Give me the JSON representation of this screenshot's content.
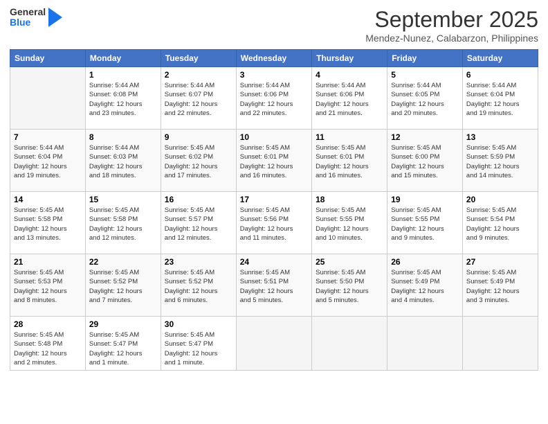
{
  "header": {
    "logo_line1": "General",
    "logo_line2": "Blue",
    "month": "September 2025",
    "location": "Mendez-Nunez, Calabarzon, Philippines"
  },
  "days_of_week": [
    "Sunday",
    "Monday",
    "Tuesday",
    "Wednesday",
    "Thursday",
    "Friday",
    "Saturday"
  ],
  "weeks": [
    [
      {
        "day": "",
        "info": ""
      },
      {
        "day": "1",
        "info": "Sunrise: 5:44 AM\nSunset: 6:08 PM\nDaylight: 12 hours\nand 23 minutes."
      },
      {
        "day": "2",
        "info": "Sunrise: 5:44 AM\nSunset: 6:07 PM\nDaylight: 12 hours\nand 22 minutes."
      },
      {
        "day": "3",
        "info": "Sunrise: 5:44 AM\nSunset: 6:06 PM\nDaylight: 12 hours\nand 22 minutes."
      },
      {
        "day": "4",
        "info": "Sunrise: 5:44 AM\nSunset: 6:06 PM\nDaylight: 12 hours\nand 21 minutes."
      },
      {
        "day": "5",
        "info": "Sunrise: 5:44 AM\nSunset: 6:05 PM\nDaylight: 12 hours\nand 20 minutes."
      },
      {
        "day": "6",
        "info": "Sunrise: 5:44 AM\nSunset: 6:04 PM\nDaylight: 12 hours\nand 19 minutes."
      }
    ],
    [
      {
        "day": "7",
        "info": "Sunrise: 5:44 AM\nSunset: 6:04 PM\nDaylight: 12 hours\nand 19 minutes."
      },
      {
        "day": "8",
        "info": "Sunrise: 5:44 AM\nSunset: 6:03 PM\nDaylight: 12 hours\nand 18 minutes."
      },
      {
        "day": "9",
        "info": "Sunrise: 5:45 AM\nSunset: 6:02 PM\nDaylight: 12 hours\nand 17 minutes."
      },
      {
        "day": "10",
        "info": "Sunrise: 5:45 AM\nSunset: 6:01 PM\nDaylight: 12 hours\nand 16 minutes."
      },
      {
        "day": "11",
        "info": "Sunrise: 5:45 AM\nSunset: 6:01 PM\nDaylight: 12 hours\nand 16 minutes."
      },
      {
        "day": "12",
        "info": "Sunrise: 5:45 AM\nSunset: 6:00 PM\nDaylight: 12 hours\nand 15 minutes."
      },
      {
        "day": "13",
        "info": "Sunrise: 5:45 AM\nSunset: 5:59 PM\nDaylight: 12 hours\nand 14 minutes."
      }
    ],
    [
      {
        "day": "14",
        "info": "Sunrise: 5:45 AM\nSunset: 5:58 PM\nDaylight: 12 hours\nand 13 minutes."
      },
      {
        "day": "15",
        "info": "Sunrise: 5:45 AM\nSunset: 5:58 PM\nDaylight: 12 hours\nand 12 minutes."
      },
      {
        "day": "16",
        "info": "Sunrise: 5:45 AM\nSunset: 5:57 PM\nDaylight: 12 hours\nand 12 minutes."
      },
      {
        "day": "17",
        "info": "Sunrise: 5:45 AM\nSunset: 5:56 PM\nDaylight: 12 hours\nand 11 minutes."
      },
      {
        "day": "18",
        "info": "Sunrise: 5:45 AM\nSunset: 5:55 PM\nDaylight: 12 hours\nand 10 minutes."
      },
      {
        "day": "19",
        "info": "Sunrise: 5:45 AM\nSunset: 5:55 PM\nDaylight: 12 hours\nand 9 minutes."
      },
      {
        "day": "20",
        "info": "Sunrise: 5:45 AM\nSunset: 5:54 PM\nDaylight: 12 hours\nand 9 minutes."
      }
    ],
    [
      {
        "day": "21",
        "info": "Sunrise: 5:45 AM\nSunset: 5:53 PM\nDaylight: 12 hours\nand 8 minutes."
      },
      {
        "day": "22",
        "info": "Sunrise: 5:45 AM\nSunset: 5:52 PM\nDaylight: 12 hours\nand 7 minutes."
      },
      {
        "day": "23",
        "info": "Sunrise: 5:45 AM\nSunset: 5:52 PM\nDaylight: 12 hours\nand 6 minutes."
      },
      {
        "day": "24",
        "info": "Sunrise: 5:45 AM\nSunset: 5:51 PM\nDaylight: 12 hours\nand 5 minutes."
      },
      {
        "day": "25",
        "info": "Sunrise: 5:45 AM\nSunset: 5:50 PM\nDaylight: 12 hours\nand 5 minutes."
      },
      {
        "day": "26",
        "info": "Sunrise: 5:45 AM\nSunset: 5:49 PM\nDaylight: 12 hours\nand 4 minutes."
      },
      {
        "day": "27",
        "info": "Sunrise: 5:45 AM\nSunset: 5:49 PM\nDaylight: 12 hours\nand 3 minutes."
      }
    ],
    [
      {
        "day": "28",
        "info": "Sunrise: 5:45 AM\nSunset: 5:48 PM\nDaylight: 12 hours\nand 2 minutes."
      },
      {
        "day": "29",
        "info": "Sunrise: 5:45 AM\nSunset: 5:47 PM\nDaylight: 12 hours\nand 1 minute."
      },
      {
        "day": "30",
        "info": "Sunrise: 5:45 AM\nSunset: 5:47 PM\nDaylight: 12 hours\nand 1 minute."
      },
      {
        "day": "",
        "info": ""
      },
      {
        "day": "",
        "info": ""
      },
      {
        "day": "",
        "info": ""
      },
      {
        "day": "",
        "info": ""
      }
    ]
  ]
}
